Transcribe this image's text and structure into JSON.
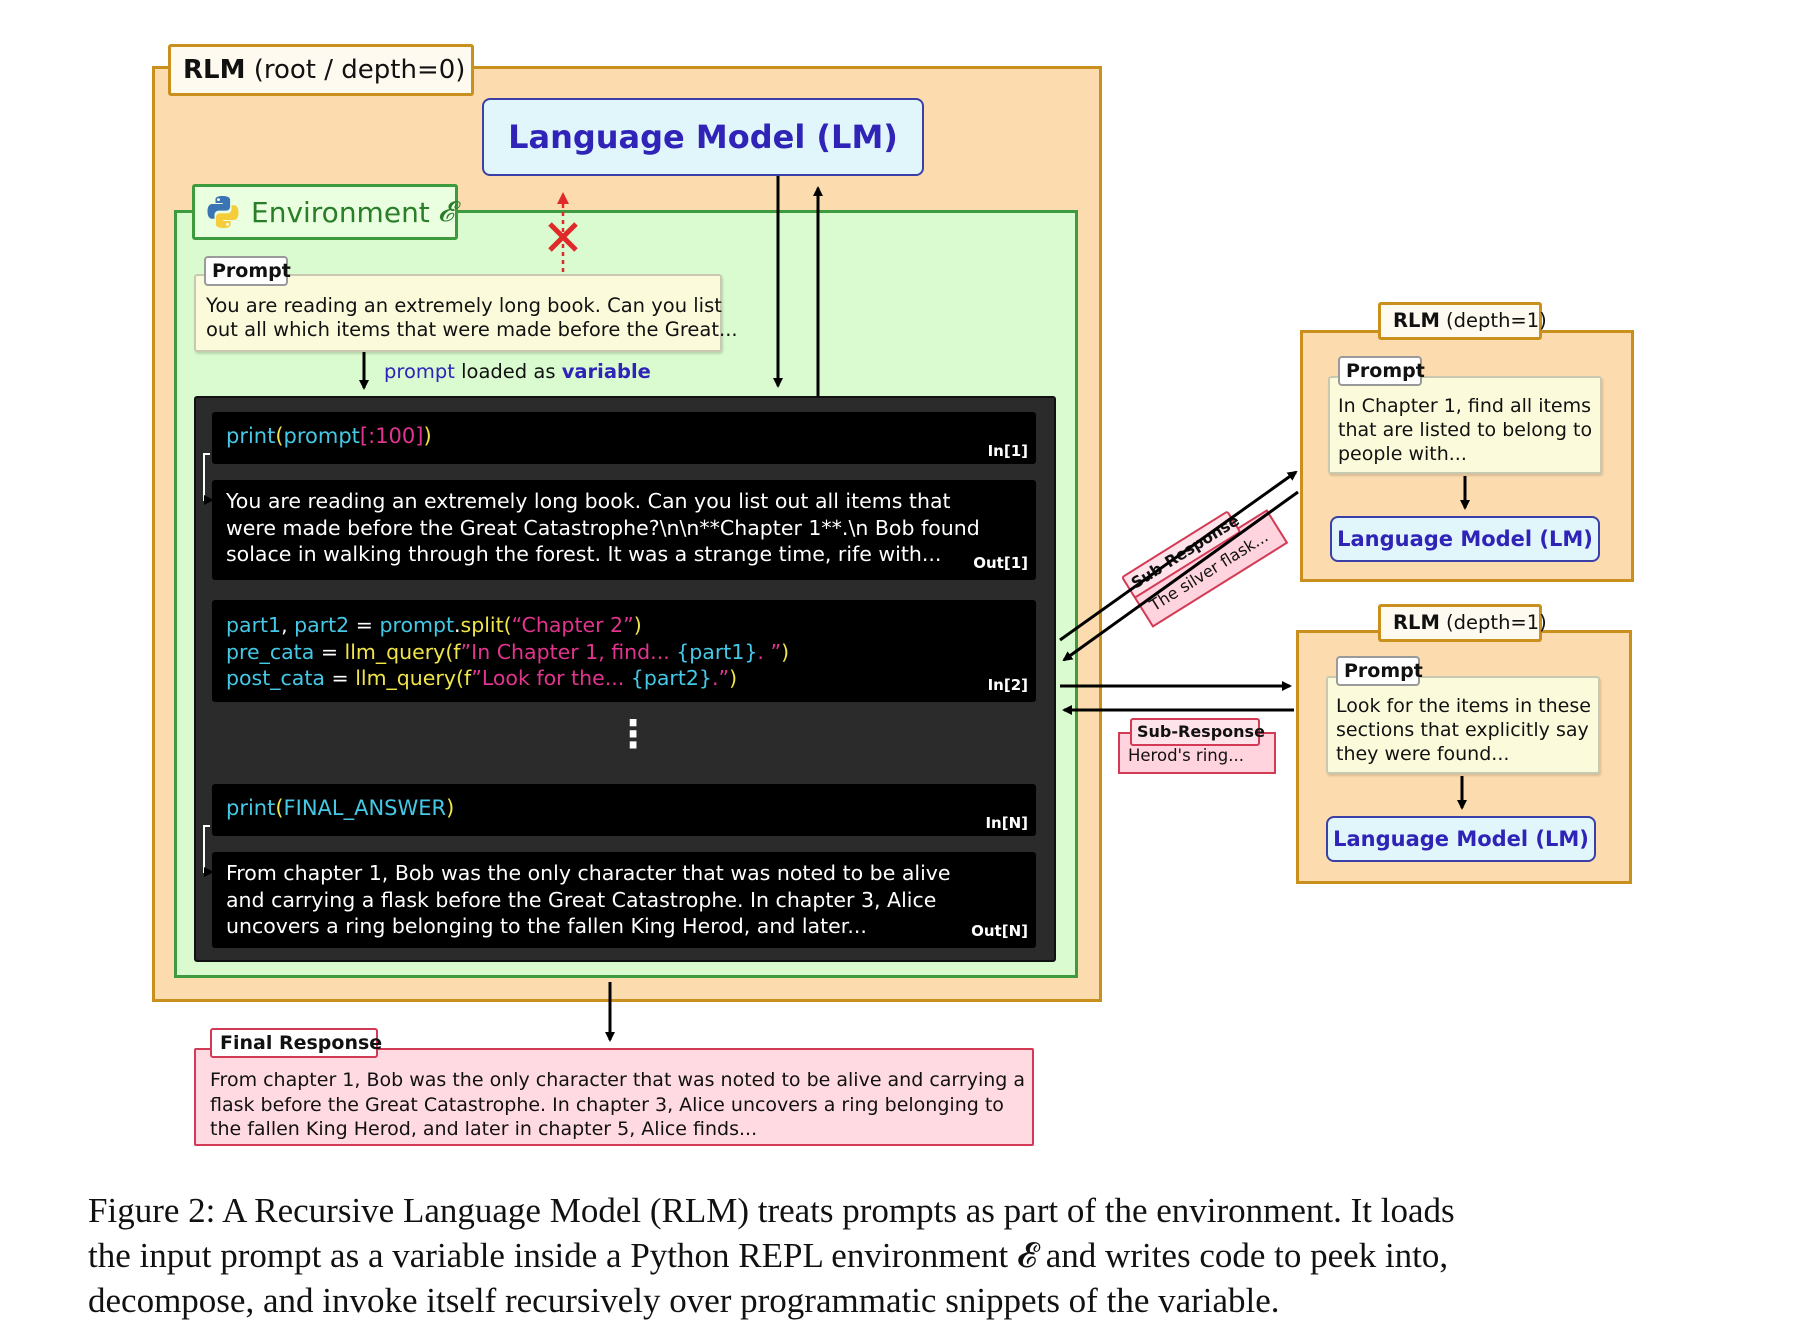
{
  "root_rlm": {
    "label_bold": "RLM",
    "label_rest": " (root / depth=0)"
  },
  "lm_main": {
    "label": "Language Model (LM)"
  },
  "environment": {
    "label": "Environment",
    "symbol": "𝓔"
  },
  "main_prompt": {
    "tab": "Prompt",
    "line1": "You are reading an extremely long book. Can you list",
    "line2": "out all which items that were made before the Great..."
  },
  "prompt_loaded": {
    "word1": "prompt",
    "middle": " loaded as ",
    "word2": "variable"
  },
  "repl": {
    "in1": {
      "fn": "print",
      "p1": "(",
      "arg": "prompt",
      "slice": "[:100]",
      "p2": ")",
      "label": "In[1]"
    },
    "out1": {
      "line1": "You are reading an extremely long book. Can you list out all items that",
      "line2": "were made before the Great Catastrophe?\\n\\n**Chapter 1**.\\n Bob found",
      "line3": "solace in walking through the forest. It was a strange time, rife with...",
      "label": "Out[1]"
    },
    "in2": {
      "l1_vars": "part1",
      "l1_comma": ", ",
      "l1_vars2": "part2",
      "l1_eq": " = ",
      "l1_obj": "prompt",
      "l1_dot": ".",
      "l1_fn": "split",
      "l1_open": "(",
      "l1_str": "“Chapter 2”",
      "l1_close": ")",
      "l2_var": "pre_cata",
      "l2_eq": " = ",
      "l2_fn": "llm_query",
      "l2_open": "(f",
      "l2_str": "”In Chapter 1, find... ",
      "l2_ref": "{part1}",
      "l2_end": ". ”",
      "l2_close": ")",
      "l3_var": "post_cata",
      "l3_eq": " = ",
      "l3_fn": "llm_query",
      "l3_open": "(f",
      "l3_str": "”Look for the... ",
      "l3_ref": "{part2}",
      "l3_end": ".”",
      "l3_close": ")",
      "label": "In[2]"
    },
    "dots": "⋮",
    "inN": {
      "fn": "print",
      "p1": "(",
      "arg": "FINAL_ANSWER",
      "p2": ")",
      "label": "In[N]"
    },
    "outN": {
      "line1": "From chapter 1, Bob was the only character that was noted to be alive",
      "line2": "and carrying a flask before the Great Catastrophe. In chapter 3, Alice",
      "line3": "uncovers a ring belonging to the fallen King Herod, and later...",
      "label": "Out[N]"
    }
  },
  "sub_rlm_1": {
    "label_bold": "RLM",
    "label_rest": " (depth=1)",
    "prompt_tab": "Prompt",
    "line1": "In Chapter 1, find all items",
    "line2": "that are listed to belong to",
    "line3": "people with...",
    "lm": "Language Model (LM)"
  },
  "sub_rlm_2": {
    "label_bold": "RLM",
    "label_rest": " (depth=1)",
    "prompt_tab": "Prompt",
    "line1": "Look for the items in these",
    "line2": "sections that explicitly say",
    "line3": "they were found...",
    "lm": "Language Model (LM)"
  },
  "sub_response_1": {
    "tab": "Sub-Response",
    "text": "The silver flask..."
  },
  "sub_response_2": {
    "tab": "Sub-Response",
    "text": "Herod's ring..."
  },
  "final_response": {
    "tab": "Final Response",
    "line1": "From chapter 1, Bob was the only character that was noted to be alive and carrying a",
    "line2": "flask before the Great Catastrophe. In chapter 3, Alice uncovers a ring belonging to",
    "line3": "the fallen King Herod, and later in chapter 5, Alice finds..."
  },
  "caption": {
    "line1": "Figure 2: A Recursive Language Model (RLM) treats prompts as part of the environment. It loads",
    "line2": "the input prompt as a variable inside a Python REPL environment 𝓔 and writes code to peek into,",
    "line3": "decompose, and invoke itself recursively over programmatic snippets of the variable."
  },
  "colors": {
    "orange_fill": "#fcdcae",
    "orange_border": "#c9901e",
    "green_fill": "#d9fbcf",
    "green_border": "#3e9a3e",
    "lm_text": "#2f23b8",
    "lm_fill": "#e0f6fb",
    "red": "#d23a55",
    "repl_bg": "#2b2b2b"
  }
}
